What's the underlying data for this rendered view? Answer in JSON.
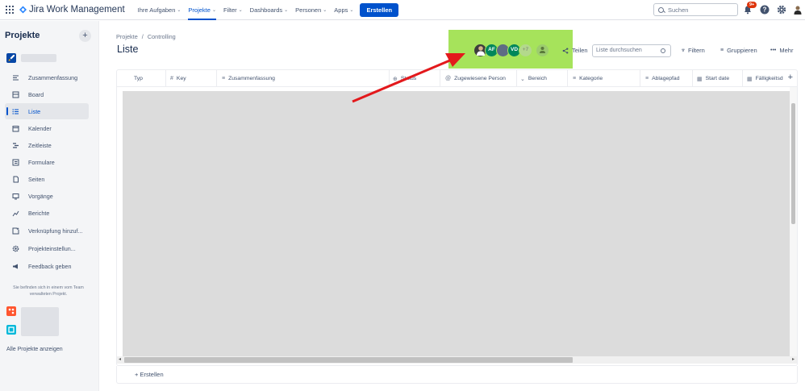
{
  "topnav": {
    "product_name": "Jira Work Management",
    "items": [
      {
        "label": "Ihre Aufgaben",
        "chevron": true,
        "active": false
      },
      {
        "label": "Projekte",
        "chevron": true,
        "active": true
      },
      {
        "label": "Filter",
        "chevron": true,
        "active": false
      },
      {
        "label": "Dashboards",
        "chevron": true,
        "active": false
      },
      {
        "label": "Personen",
        "chevron": true,
        "active": false
      },
      {
        "label": "Apps",
        "chevron": true,
        "active": false
      }
    ],
    "create_label": "Erstellen",
    "search_placeholder": "Suchen",
    "notification_badge": "9+"
  },
  "sidebar": {
    "title": "Projekte",
    "items": [
      {
        "label": "Zusammenfassung",
        "icon": "summary-icon"
      },
      {
        "label": "Board",
        "icon": "board-icon"
      },
      {
        "label": "Liste",
        "icon": "list-icon",
        "active": true
      },
      {
        "label": "Kalender",
        "icon": "calendar-icon"
      },
      {
        "label": "Zeitleiste",
        "icon": "timeline-icon"
      },
      {
        "label": "Formulare",
        "icon": "forms-icon"
      },
      {
        "label": "Seiten",
        "icon": "pages-icon"
      },
      {
        "label": "Vorgänge",
        "icon": "issues-icon"
      },
      {
        "label": "Berichte",
        "icon": "reports-icon"
      },
      {
        "label": "Verknüpfung hinzuf...",
        "icon": "add-shortcut-icon"
      },
      {
        "label": "Projekteinstellun...",
        "icon": "gear-icon"
      },
      {
        "label": "Feedback geben",
        "icon": "megaphone-icon"
      }
    ],
    "note": "Sie befinden sich in einem vom Team verwalteten Projekt.",
    "all_projects_label": "Alle Projekte anzeigen"
  },
  "main": {
    "breadcrumb": [
      "Projekte",
      "Controlling"
    ],
    "title": "Liste",
    "avatars": [
      "AF",
      "VD",
      "+7"
    ],
    "share_label": "Teilen",
    "list_search_placeholder": "Liste durchsuchen",
    "filter_label": "Filtern",
    "group_label": "Gruppieren",
    "more_label": "Mehr",
    "columns": [
      {
        "label": "Typ",
        "icon": ""
      },
      {
        "label": "Key",
        "icon": "#"
      },
      {
        "label": "Zusammenfassung",
        "icon": "≡"
      },
      {
        "label": "Status",
        "icon": "⊕"
      },
      {
        "label": "Zugewiesene Person",
        "icon": "@"
      },
      {
        "label": "Bereich",
        "icon": "⌄"
      },
      {
        "label": "Kategorie",
        "icon": "≡"
      },
      {
        "label": "Ablagepfad",
        "icon": "≡"
      },
      {
        "label": "Start date",
        "icon": "▦"
      },
      {
        "label": "Fälligkeitsd",
        "icon": "▦"
      }
    ],
    "create_label": "Erstellen"
  },
  "colors": {
    "brand": "#0052cc",
    "highlight": "#a6e35b",
    "annotation_arrow": "#e3191c"
  }
}
